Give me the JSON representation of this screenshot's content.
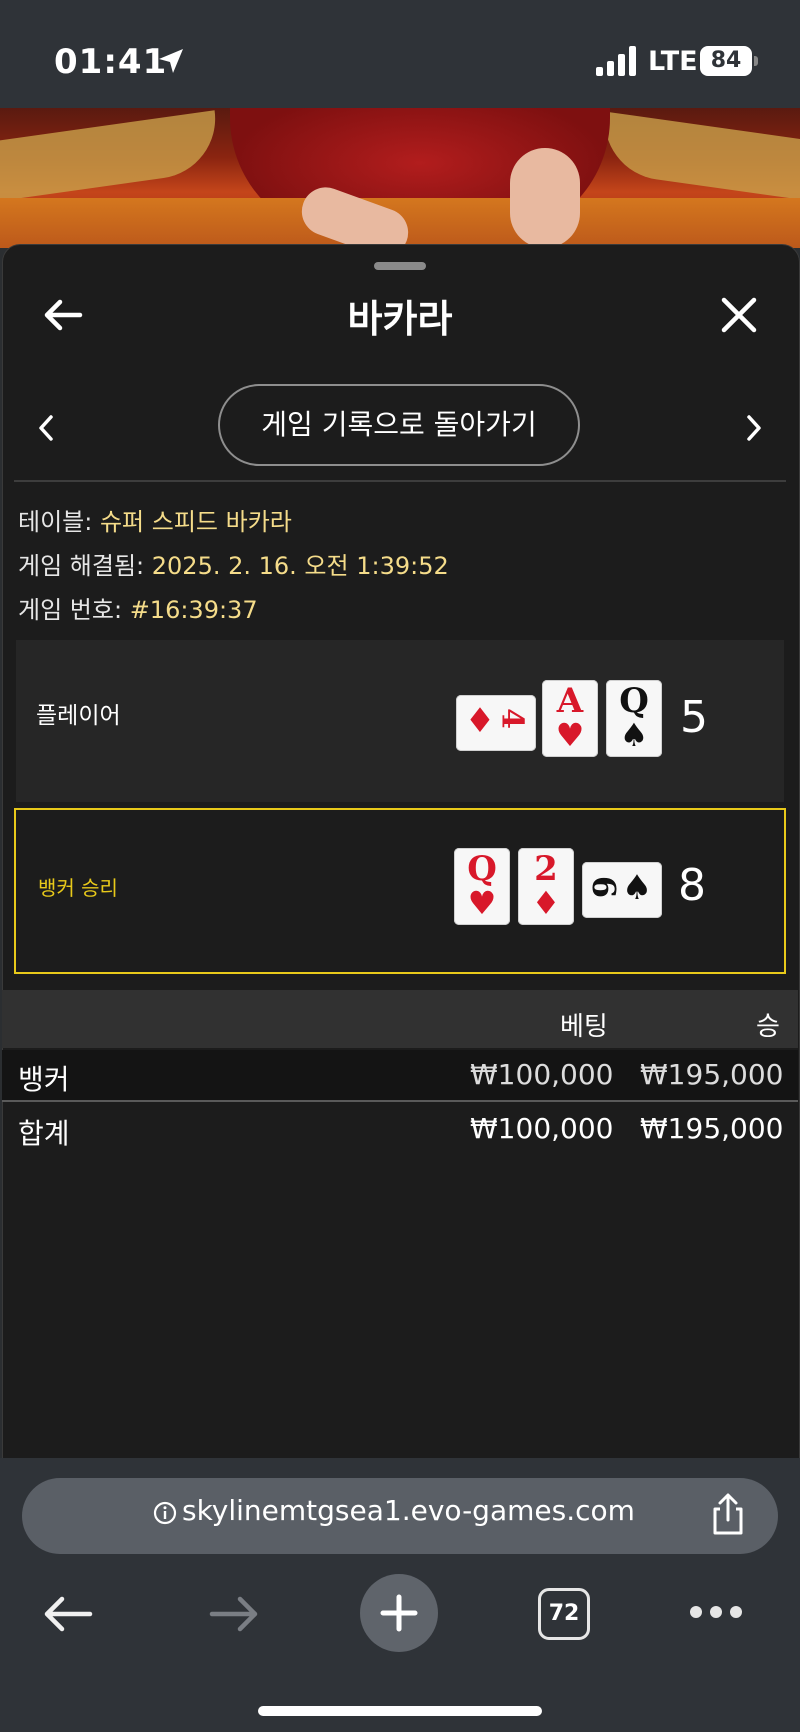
{
  "status": {
    "time": "01:41",
    "network": "LTE",
    "battery": "84"
  },
  "header": {
    "title": "바카라",
    "history_button": "게임 기록으로 돌아가기"
  },
  "info": [
    {
      "label": "테이블:",
      "value": "슈퍼 스피드 바카라"
    },
    {
      "label": "게임 해결됨:",
      "value": "2025. 2. 16. 오전 1:39:52"
    },
    {
      "label": "게임 번호:",
      "value": "#16:39:37"
    }
  ],
  "player": {
    "label": "플레이어",
    "score": "5",
    "cards": [
      {
        "rank": "4",
        "suit": "♦",
        "color": "red",
        "orientation": "sideways"
      },
      {
        "rank": "A",
        "suit": "♥",
        "color": "red",
        "orientation": "upright"
      },
      {
        "rank": "Q",
        "suit": "♠",
        "color": "black",
        "orientation": "upright"
      }
    ]
  },
  "banker": {
    "label": "뱅커 승리",
    "score": "8",
    "accent": "#e8c91a",
    "cards": [
      {
        "rank": "Q",
        "suit": "♥",
        "color": "red",
        "orientation": "upright"
      },
      {
        "rank": "2",
        "suit": "♦",
        "color": "red",
        "orientation": "upright"
      },
      {
        "rank": "6",
        "suit": "♠",
        "color": "black",
        "orientation": "sideways"
      }
    ]
  },
  "bets_table": {
    "headers": {
      "bet": "베팅",
      "win": "승"
    },
    "rows": [
      {
        "name": "뱅커",
        "bet": "₩100,000",
        "win": "₩195,000"
      }
    ],
    "total": {
      "name": "합계",
      "bet": "₩100,000",
      "win": "₩195,000"
    }
  },
  "browser": {
    "url": "skylinemtgsea1.evo-games.com",
    "tab_count": "72"
  }
}
